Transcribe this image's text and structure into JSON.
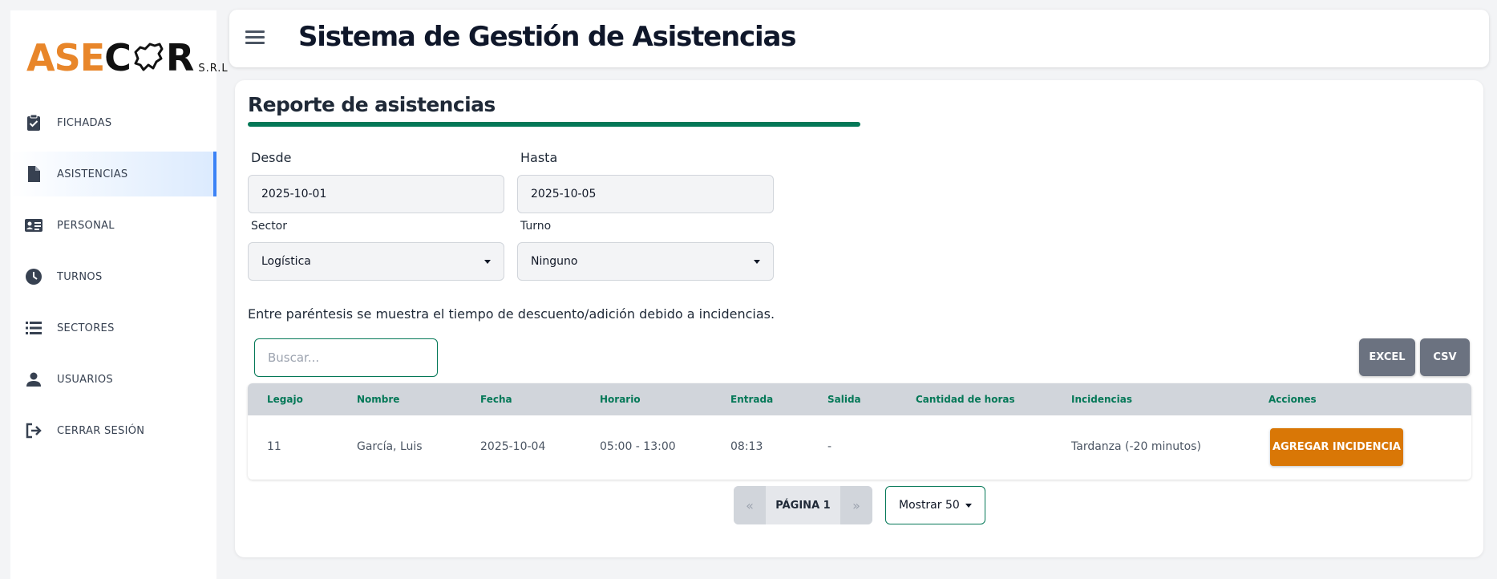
{
  "logo": {
    "part1": "ASE",
    "part2": "C",
    "part3": "R",
    "suffix": "S.R.L"
  },
  "sidebar": {
    "items": [
      {
        "label": "FICHADAS",
        "icon": "clipboard-check-icon"
      },
      {
        "label": "ASISTENCIAS",
        "icon": "document-icon",
        "active": true
      },
      {
        "label": "PERSONAL",
        "icon": "id-card-icon"
      },
      {
        "label": "TURNOS",
        "icon": "clock-icon"
      },
      {
        "label": "SECTORES",
        "icon": "list-icon"
      },
      {
        "label": "USUARIOS",
        "icon": "person-icon"
      },
      {
        "label": "CERRAR SESIÓN",
        "icon": "logout-icon"
      }
    ]
  },
  "header": {
    "title": "Sistema de Gestión de Asistencias"
  },
  "report": {
    "title": "Reporte de asistencias",
    "desde": {
      "label": "Desde",
      "value": "2025-10-01"
    },
    "hasta": {
      "label": "Hasta",
      "value": "2025-10-05"
    },
    "sector": {
      "label": "Sector",
      "value": "Logística"
    },
    "turno": {
      "label": "Turno",
      "value": "Ninguno"
    },
    "info": "Entre paréntesis se muestra el tiempo de descuento/adición debido a incidencias.",
    "search_placeholder": "Buscar...",
    "excel_label": "EXCEL",
    "csv_label": "CSV"
  },
  "table": {
    "columns": [
      "Legajo",
      "Nombre",
      "Fecha",
      "Horario",
      "Entrada",
      "Salida",
      "Cantidad de horas",
      "Incidencias",
      "Acciones"
    ],
    "rows": [
      {
        "legajo": "11",
        "nombre": "García, Luis",
        "fecha": "2025-10-04",
        "horario": "05:00 - 13:00",
        "entrada": "08:13",
        "salida": "-",
        "horas": "",
        "incidencias": "Tardanza (-20 minutos)",
        "accion": "AGREGAR INCIDENCIA"
      }
    ]
  },
  "pagination": {
    "prev": "«",
    "label": "PÁGINA 1",
    "next": "»",
    "show": "Mostrar 50"
  },
  "colors": {
    "brand_orange": "#e8862a",
    "accent_green": "#047857",
    "action_orange": "#d97706",
    "active_blue": "#3b82f6"
  }
}
